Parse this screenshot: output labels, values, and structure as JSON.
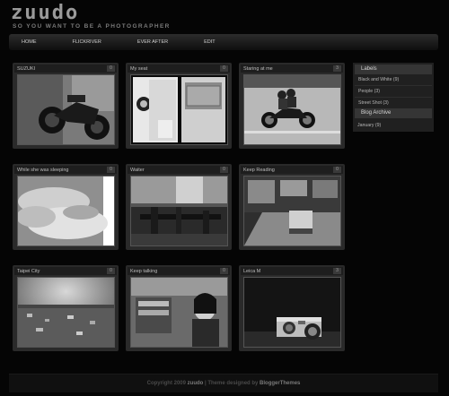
{
  "site": {
    "title": "zuudo",
    "tagline": "SO YOU WANT TO BE A PHOTOGRAPHER"
  },
  "nav": [
    "HOME",
    "FLICKRIVER",
    "EVER AFTER",
    "EDIT"
  ],
  "posts": [
    {
      "title": "SUZUKI",
      "count": "0"
    },
    {
      "title": "My seat",
      "count": "0"
    },
    {
      "title": "Staring at me",
      "count": "3"
    },
    {
      "title": "While she was sleeping",
      "count": "0"
    },
    {
      "title": "Waiter",
      "count": "0"
    },
    {
      "title": "Keep Reading",
      "count": "0"
    },
    {
      "title": "Taipei City",
      "count": "0"
    },
    {
      "title": "Keep talking",
      "count": "0"
    },
    {
      "title": "Leica M",
      "count": "3"
    }
  ],
  "sidebar": {
    "labels_heading": "Labels",
    "labels": [
      "Black and White (9)",
      "People (3)",
      "Street Shot (3)"
    ],
    "archive_heading": "Blog Archive",
    "archive": [
      "January (9)"
    ]
  },
  "footer": {
    "prefix": "Copyright 2009",
    "site": "zuudo",
    "middle": "| Theme designed by",
    "designer": "BloggerThemes"
  }
}
